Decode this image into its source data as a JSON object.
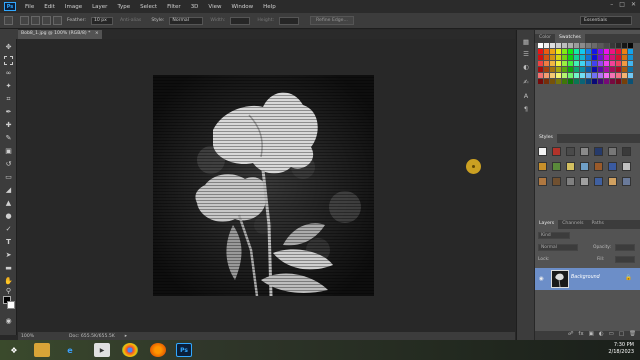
{
  "menubar": {
    "logo": "Ps",
    "items": [
      "File",
      "Edit",
      "Image",
      "Layer",
      "Type",
      "Select",
      "Filter",
      "3D",
      "View",
      "Window",
      "Help"
    ]
  },
  "options": {
    "feather_label": "Feather:",
    "feather_value": "10 px",
    "antialias_label": "Anti-alias",
    "style_label": "Style:",
    "style_value": "Normal",
    "width_label": "Width:",
    "height_label": "Height:",
    "refine_edge": "Refine Edge...",
    "workspace": "Essentials"
  },
  "document": {
    "tab_title": "Bob8_1.jpg @ 100% (RGB/8) *",
    "zoom": "100%",
    "doc_size": "Doc: 655.5K/655.5K"
  },
  "panels": {
    "color_tab": "Color",
    "swatches_tab": "Swatches",
    "styles_tab": "Styles",
    "layers_tab": "Layers",
    "channels_tab": "Channels",
    "paths_tab": "Paths",
    "kind_label": "Kind",
    "blend_mode": "Normal",
    "opacity_label": "Opacity:",
    "lock_label": "Lock:",
    "fill_label": "Fill:",
    "layer_name": "Background"
  },
  "taskbar": {
    "time": "7:30 PM",
    "date": "2/18/2023"
  },
  "colors": {
    "accent": "#31a8ff",
    "layer_selected": "#6c8ec8",
    "cursor": "#e8b521"
  }
}
